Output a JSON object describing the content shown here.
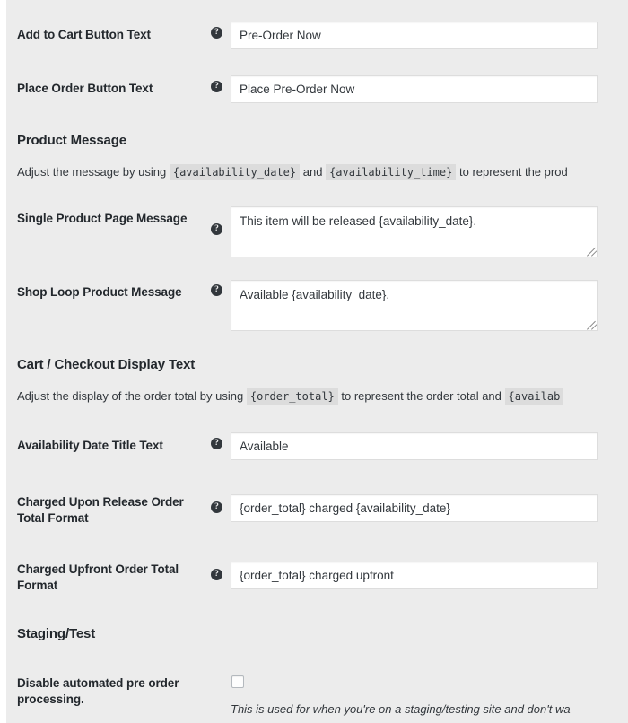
{
  "page": {
    "background": "#ececec",
    "accent": "#32373c"
  },
  "fields": {
    "add_to_cart": {
      "label": "Add to Cart Button Text",
      "value": "Pre-Order Now",
      "help": "?"
    },
    "place_order": {
      "label": "Place Order Button Text",
      "value": "Place Pre-Order Now",
      "help": "?"
    },
    "single_product_message": {
      "label": "Single Product Page Message",
      "value": "This item will be released {availability_date}.",
      "help": "?"
    },
    "shop_loop_message": {
      "label": "Shop Loop Product Message",
      "value": "Available {availability_date}.",
      "help": "?"
    },
    "availability_title": {
      "label": "Availability Date Title Text",
      "value": "Available",
      "help": "?"
    },
    "charged_upon_release": {
      "label": "Charged Upon Release Order Total Format",
      "value": "{order_total} charged {availability_date}",
      "help": "?"
    },
    "charged_upfront": {
      "label": "Charged Upfront Order Total Format",
      "value": "{order_total} charged upfront",
      "help": "?"
    },
    "disable_processing": {
      "label": "Disable automated pre order processing.",
      "checked": false,
      "hint": "This is used for when you're on a staging/testing site and don't wa"
    }
  },
  "sections": {
    "product_message": {
      "title": "Product Message",
      "desc_part1": "Adjust the message by using",
      "token1": "{availability_date}",
      "desc_part2": "and",
      "token2": "{availability_time}",
      "desc_part3": "to represent the prod"
    },
    "cart_checkout": {
      "title": "Cart / Checkout Display Text",
      "desc_part1": "Adjust the display of the order total by using",
      "token1": "{order_total}",
      "desc_part2": "to represent the order total and",
      "token2": "{availab"
    },
    "staging": {
      "title": "Staging/Test"
    }
  }
}
